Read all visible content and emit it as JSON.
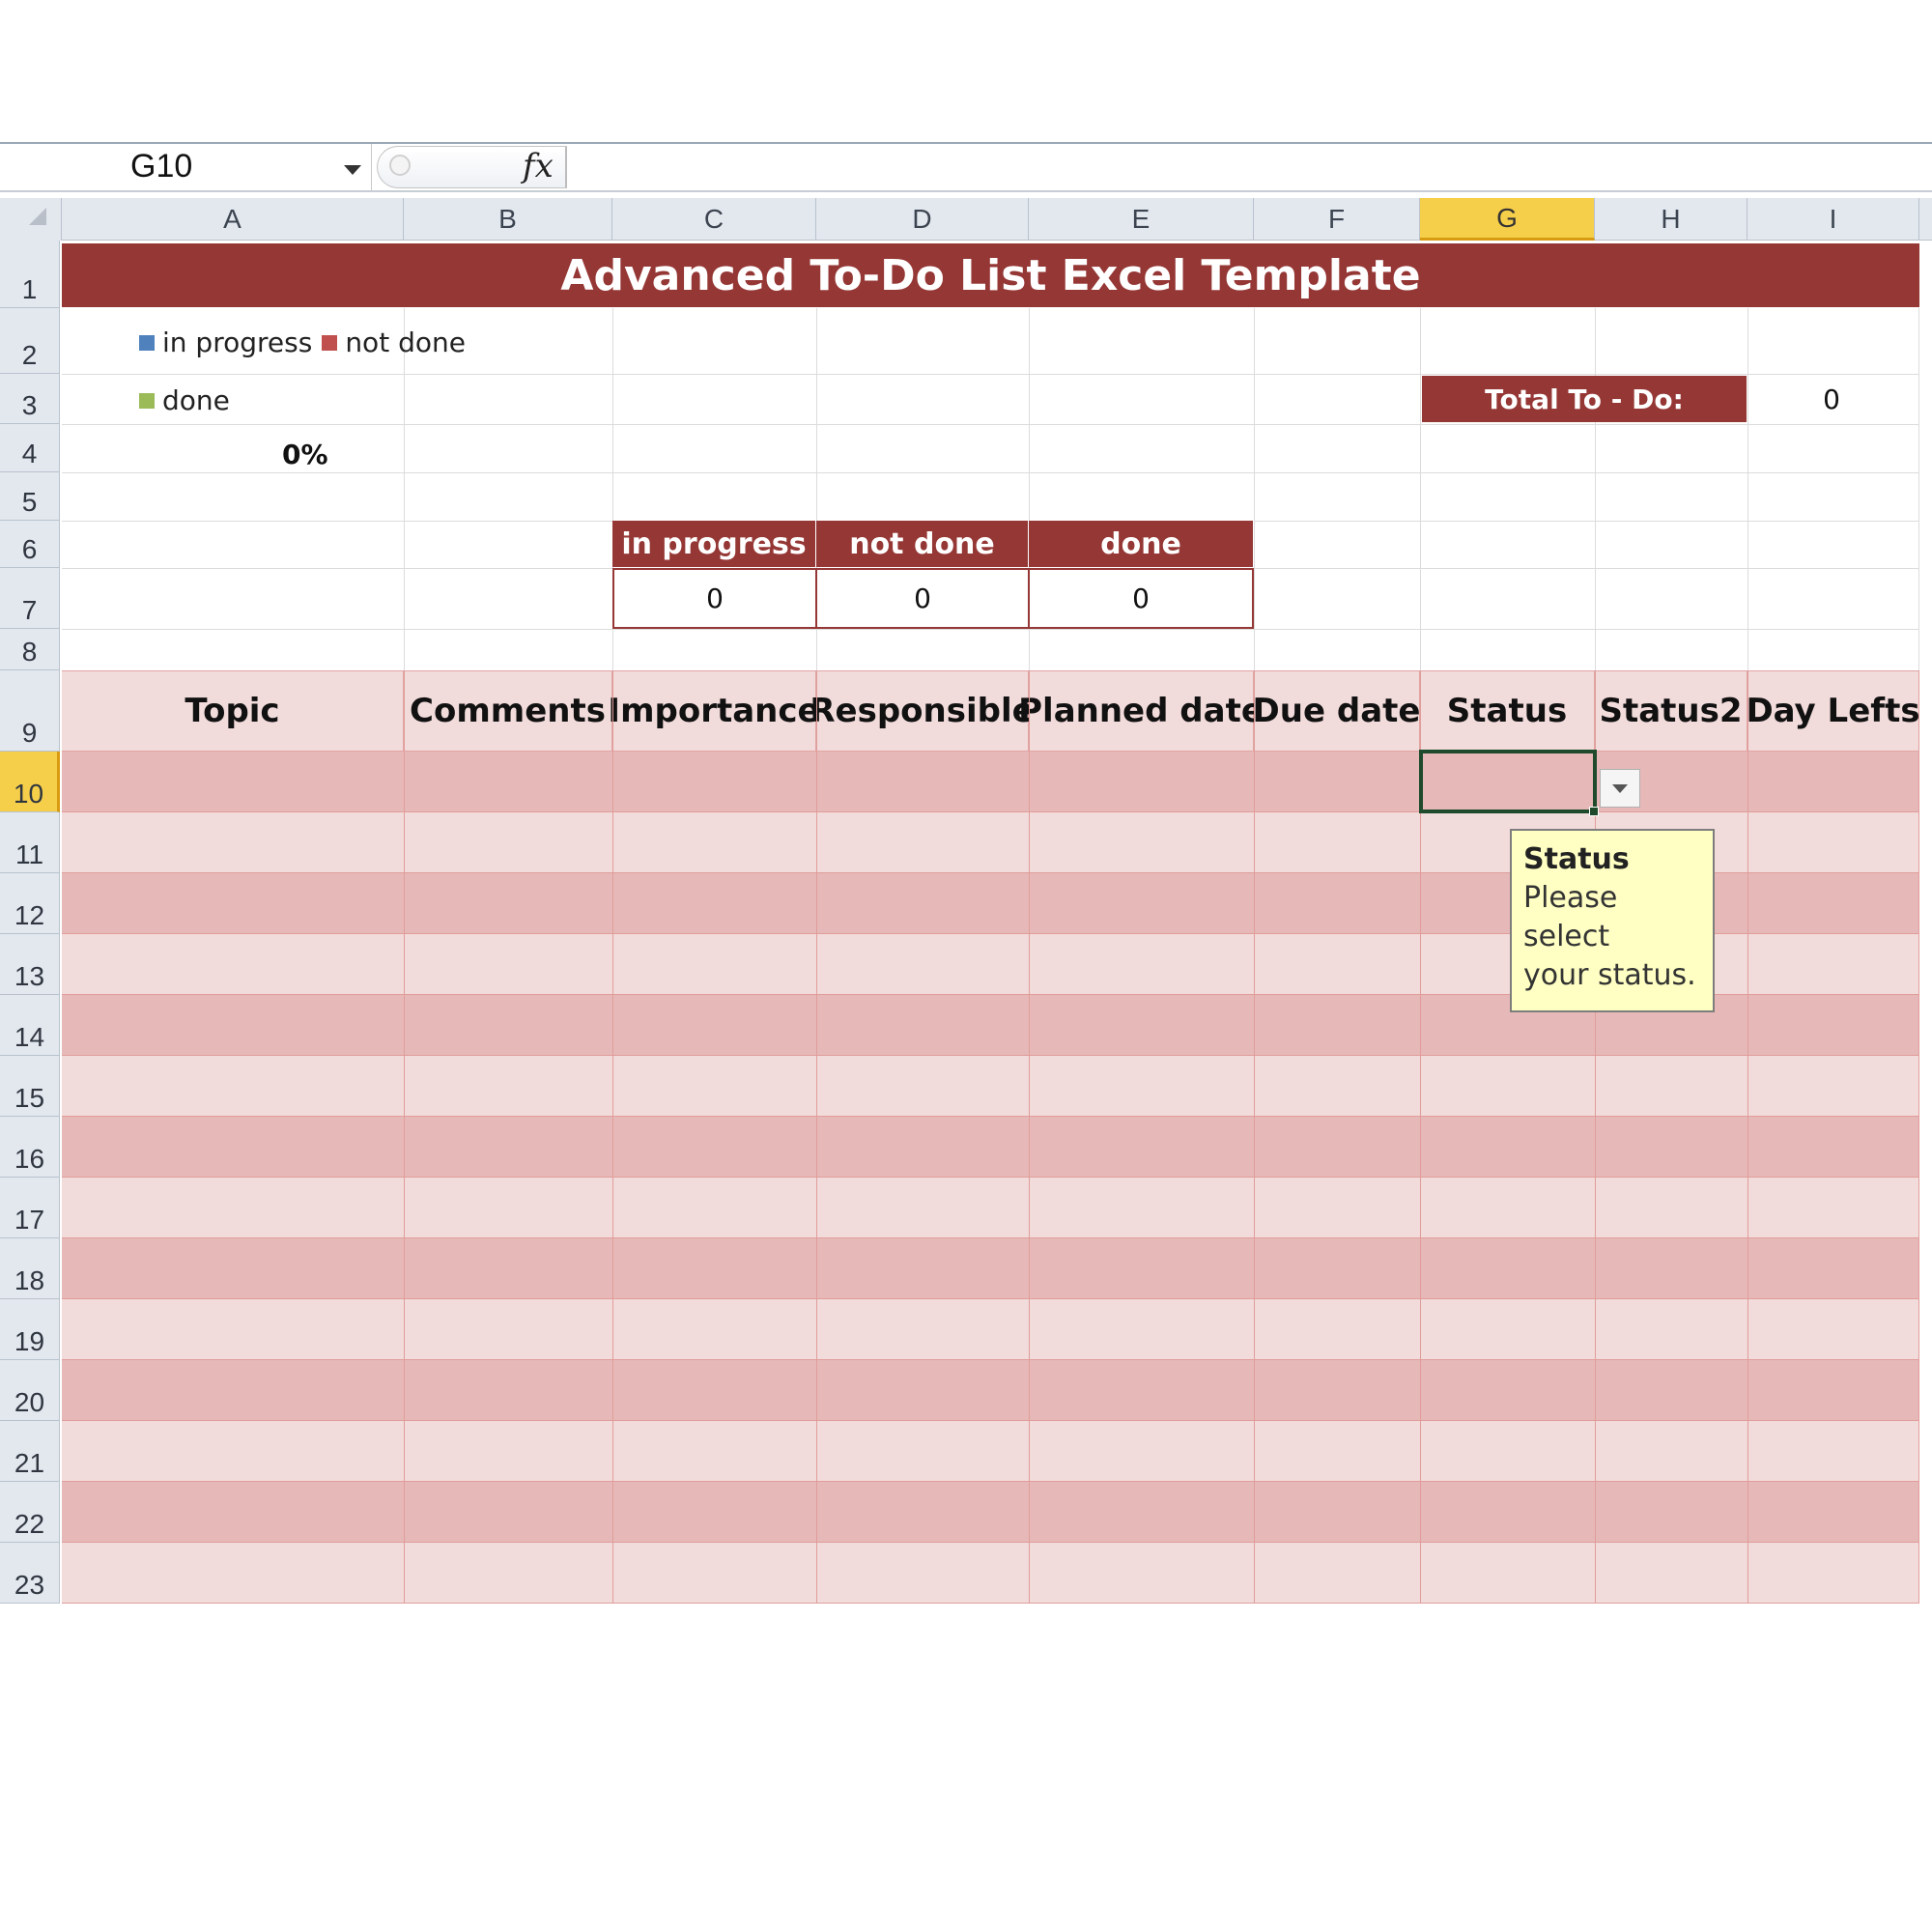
{
  "name_box": {
    "value": "G10"
  },
  "formula_bar": {
    "fx_symbol": "fx",
    "value": ""
  },
  "columns": [
    "A",
    "B",
    "C",
    "D",
    "E",
    "F",
    "G",
    "H",
    "I"
  ],
  "rows": [
    "1",
    "2",
    "3",
    "4",
    "5",
    "6",
    "7",
    "8",
    "9",
    "10",
    "11",
    "12",
    "13",
    "14",
    "15",
    "16",
    "17",
    "18",
    "19",
    "20",
    "21",
    "22",
    "23"
  ],
  "selected_cell": {
    "column": "G",
    "row": "10"
  },
  "sheet": {
    "title": "Advanced To-Do List Excel Template",
    "legend": {
      "in_progress": "in progress",
      "not_done": "not done",
      "done": "done",
      "colors": {
        "in_progress": "#4f81bd",
        "not_done": "#c0504d",
        "done": "#9bbb59"
      }
    },
    "percent_done": "0%",
    "total_label": "Total To - Do:",
    "total_value": "0",
    "summary": {
      "headers": [
        "in progress",
        "not done",
        "done"
      ],
      "values": [
        "0",
        "0",
        "0"
      ]
    },
    "table": {
      "headers": [
        "Topic",
        "Comments",
        "Importance",
        "Responsible",
        "Planned date",
        "Due date",
        "Status",
        "Status2",
        "Day Lefts"
      ]
    }
  },
  "tooltip": {
    "title": "Status",
    "line1": "Please select",
    "line2": "your status."
  },
  "colors": {
    "accent": "#953735",
    "band_light": "#f2dcdb",
    "band_dark": "#e6b9b8",
    "selection": "#1f4a2c"
  }
}
